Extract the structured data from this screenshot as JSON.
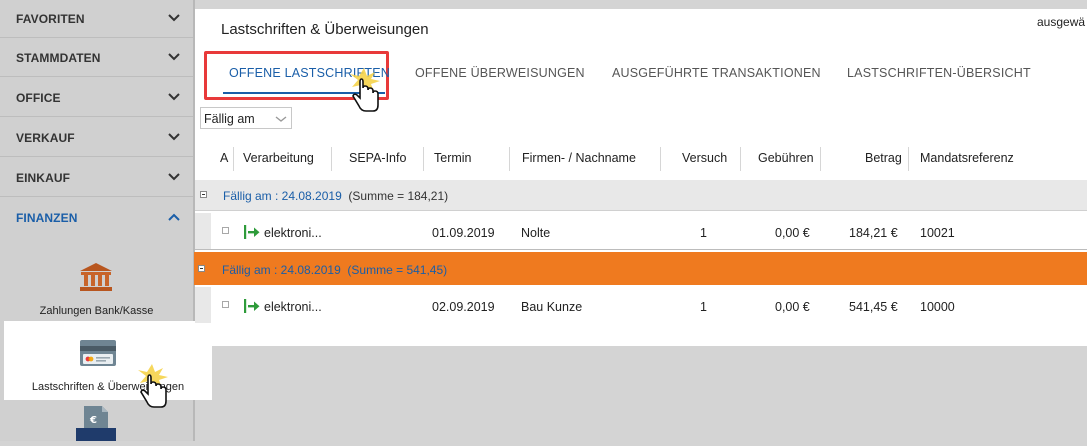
{
  "sidebar": {
    "sections": [
      {
        "label": "FAVORITEN"
      },
      {
        "label": "STAMMDATEN"
      },
      {
        "label": "OFFICE"
      },
      {
        "label": "VERKAUF"
      },
      {
        "label": "EINKAUF"
      },
      {
        "label": "FINANZEN"
      }
    ],
    "finance_items": {
      "bank": "Zahlungen Bank/Kasse",
      "debits": "Lastschriften & Überweisungen"
    }
  },
  "main": {
    "title": "Lastschriften & Überweisungen",
    "user_label": "ausgewä",
    "tabs": [
      {
        "label": "OFFENE LASTSCHRIFTEN"
      },
      {
        "label": "OFFENE ÜBERWEISUNGEN"
      },
      {
        "label": "AUSGEFÜHRTE TRANSAKTIONEN"
      },
      {
        "label": "LASTSCHRIFTEN-ÜBERSICHT"
      }
    ],
    "group_by": "Fällig am",
    "columns": [
      "A",
      "Verarbeitung",
      "SEPA-Info",
      "Termin",
      "Firmen- / Nachname",
      "Versuch",
      "Gebühren",
      "Betrag",
      "Mandatsreferenz"
    ],
    "groups": [
      {
        "title": "Fällig am : 24.08.2019",
        "sum": "(Summe = 184,21)",
        "row": {
          "verarbeitung": "elektroni...",
          "termin": "01.09.2019",
          "name": "Nolte",
          "versuch": "1",
          "gebuehren": "0,00 €",
          "betrag": "184,21 €",
          "mandat": "10021"
        }
      },
      {
        "title": "Fällig am : 24.08.2019",
        "sum": "(Summe = 541,45)",
        "row": {
          "verarbeitung": "elektroni...",
          "termin": "02.09.2019",
          "name": "Bau Kunze",
          "versuch": "1",
          "gebuehren": "0,00 €",
          "betrag": "541,45 €",
          "mandat": "10000"
        }
      }
    ]
  },
  "colors": {
    "accent": "#1a5ea8",
    "group_highlight": "#ef7a1f",
    "tab_highlight_box": "#e8393a",
    "arrow_green": "#2e9b3a"
  }
}
